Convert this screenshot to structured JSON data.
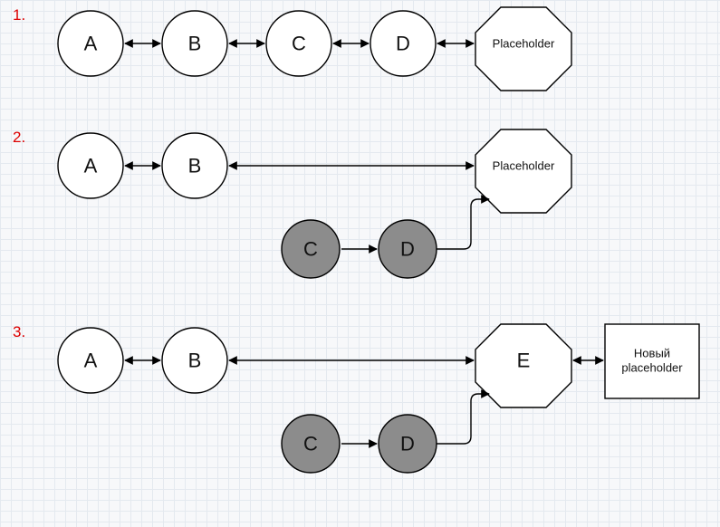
{
  "diagrams": [
    {
      "number": "1.",
      "top_row_nodes": [
        "A",
        "B",
        "C",
        "D"
      ],
      "octagon_label": "Placeholder",
      "bottom_row_nodes": [],
      "new_box_label": null
    },
    {
      "number": "2.",
      "top_row_nodes": [
        "A",
        "B"
      ],
      "octagon_label": "Placeholder",
      "bottom_row_nodes": [
        "C",
        "D"
      ],
      "new_box_label": null
    },
    {
      "number": "3.",
      "top_row_nodes": [
        "A",
        "B"
      ],
      "octagon_label": "E",
      "bottom_row_nodes": [
        "C",
        "D"
      ],
      "new_box_label": "Новый\nplaceholder"
    }
  ]
}
